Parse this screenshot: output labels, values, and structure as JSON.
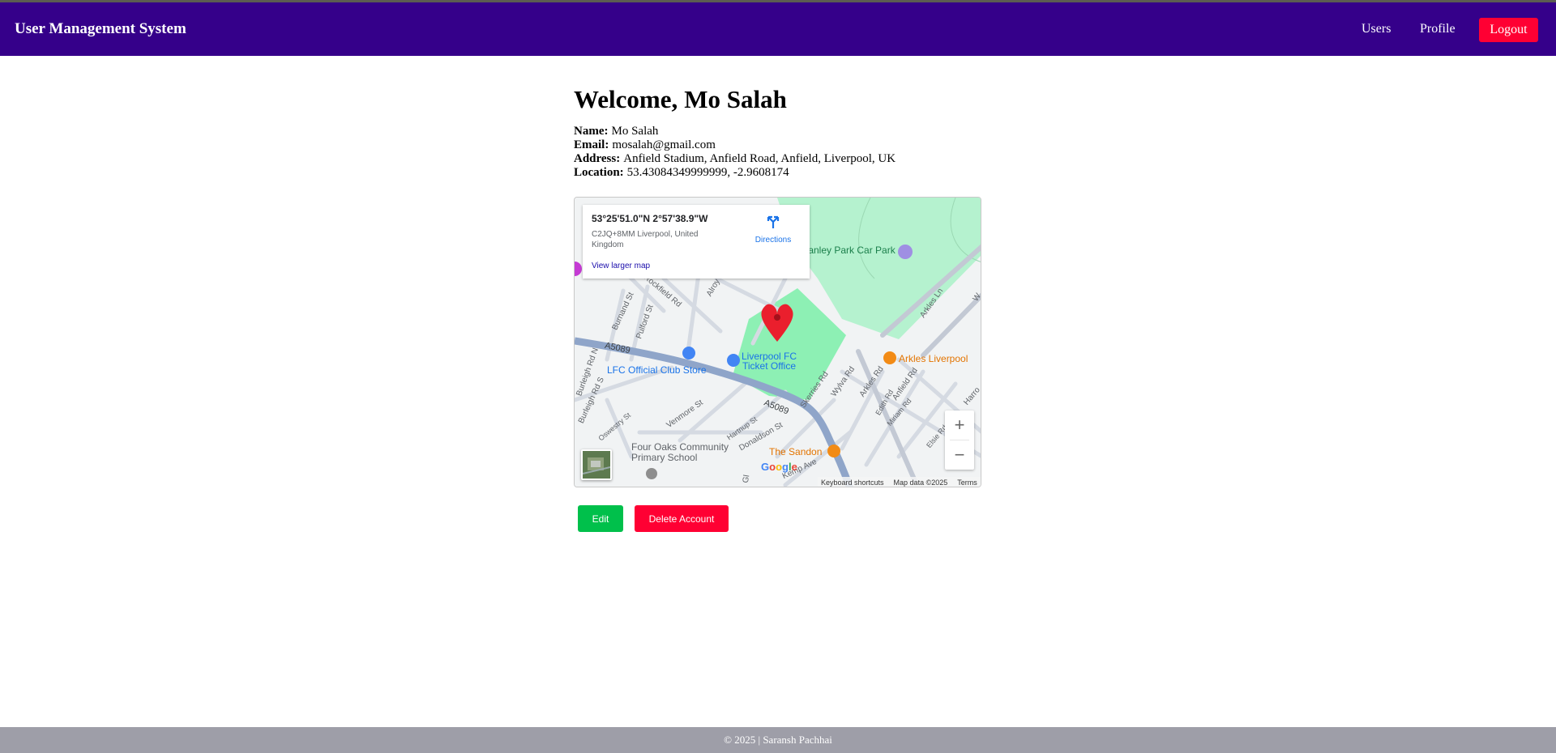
{
  "navbar": {
    "brand": "User Management System",
    "links": [
      "Users",
      "Profile"
    ],
    "logout_label": "Logout",
    "bg_color": "#35008a",
    "logout_color": "#ff0033"
  },
  "profile": {
    "welcome_prefix": "Welcome,",
    "welcome_name": "Mo Salah",
    "fields": [
      {
        "label": "Name:",
        "value": "Mo Salah"
      },
      {
        "label": "Email:",
        "value": "mosalah@gmail.com"
      },
      {
        "label": "Address:",
        "value": "Anfield Stadium, Anfield Road, Anfield, Liverpool, UK"
      },
      {
        "label": "Location:",
        "value": "53.43084349999999, -2.9608174"
      }
    ]
  },
  "map": {
    "info": {
      "coords": "53°25'51.0\"N 2°57'38.9\"W",
      "address": "C2JQ+8MM Liverpool, United Kingdom",
      "view_larger": "View larger map",
      "directions": "Directions"
    },
    "labels": {
      "car_park": "Stanley Park Car Park",
      "ticket_office_1": "Liverpool FC",
      "ticket_office_2": "Ticket Office",
      "club_store": "LFC Official Club Store",
      "arkles": "Arkles Liverpool",
      "sandon": "The Sandon",
      "school_1": "Four Oaks Community",
      "school_2": "Primary School",
      "a5089_a": "A5089",
      "a5089_b": "A5089",
      "rockfield": "Rockfield Rd",
      "alroy": "Alroy",
      "burnand": "Burnand St",
      "pulford": "Pulford St",
      "burleigh_n": "Burleigh Rd N",
      "burleigh_s": "Burleigh Rd S",
      "venmore": "Venmore St",
      "hartnup": "Hartnup St",
      "donaldson": "Donaldson St",
      "skerries": "Skerries Rd",
      "wylva": "Wylva Rd",
      "arkles_rd": "Arkles Rd",
      "anfield_rd": "Anfield Rd",
      "edith": "Edith Rd",
      "miriam": "Miriam Rd",
      "elsie": "Elsie Rd",
      "kemp": "Kemp Ave",
      "oswestry": "Oswestry St",
      "arkles_ln": "Arkles Ln",
      "gl": "Gl",
      "harro": "Harro",
      "w": "W"
    },
    "zoom_in": "+",
    "zoom_out": "−",
    "google": "Google",
    "attribution": {
      "shortcuts": "Keyboard shortcuts",
      "map_data": "Map data ©2025",
      "terms": "Terms"
    }
  },
  "actions": {
    "edit_label": "Edit",
    "delete_label": "Delete Account",
    "edit_color": "#00c04b",
    "delete_color": "#ff0033"
  },
  "footer": {
    "text": "© 2025 | Saransh Pachhai"
  }
}
